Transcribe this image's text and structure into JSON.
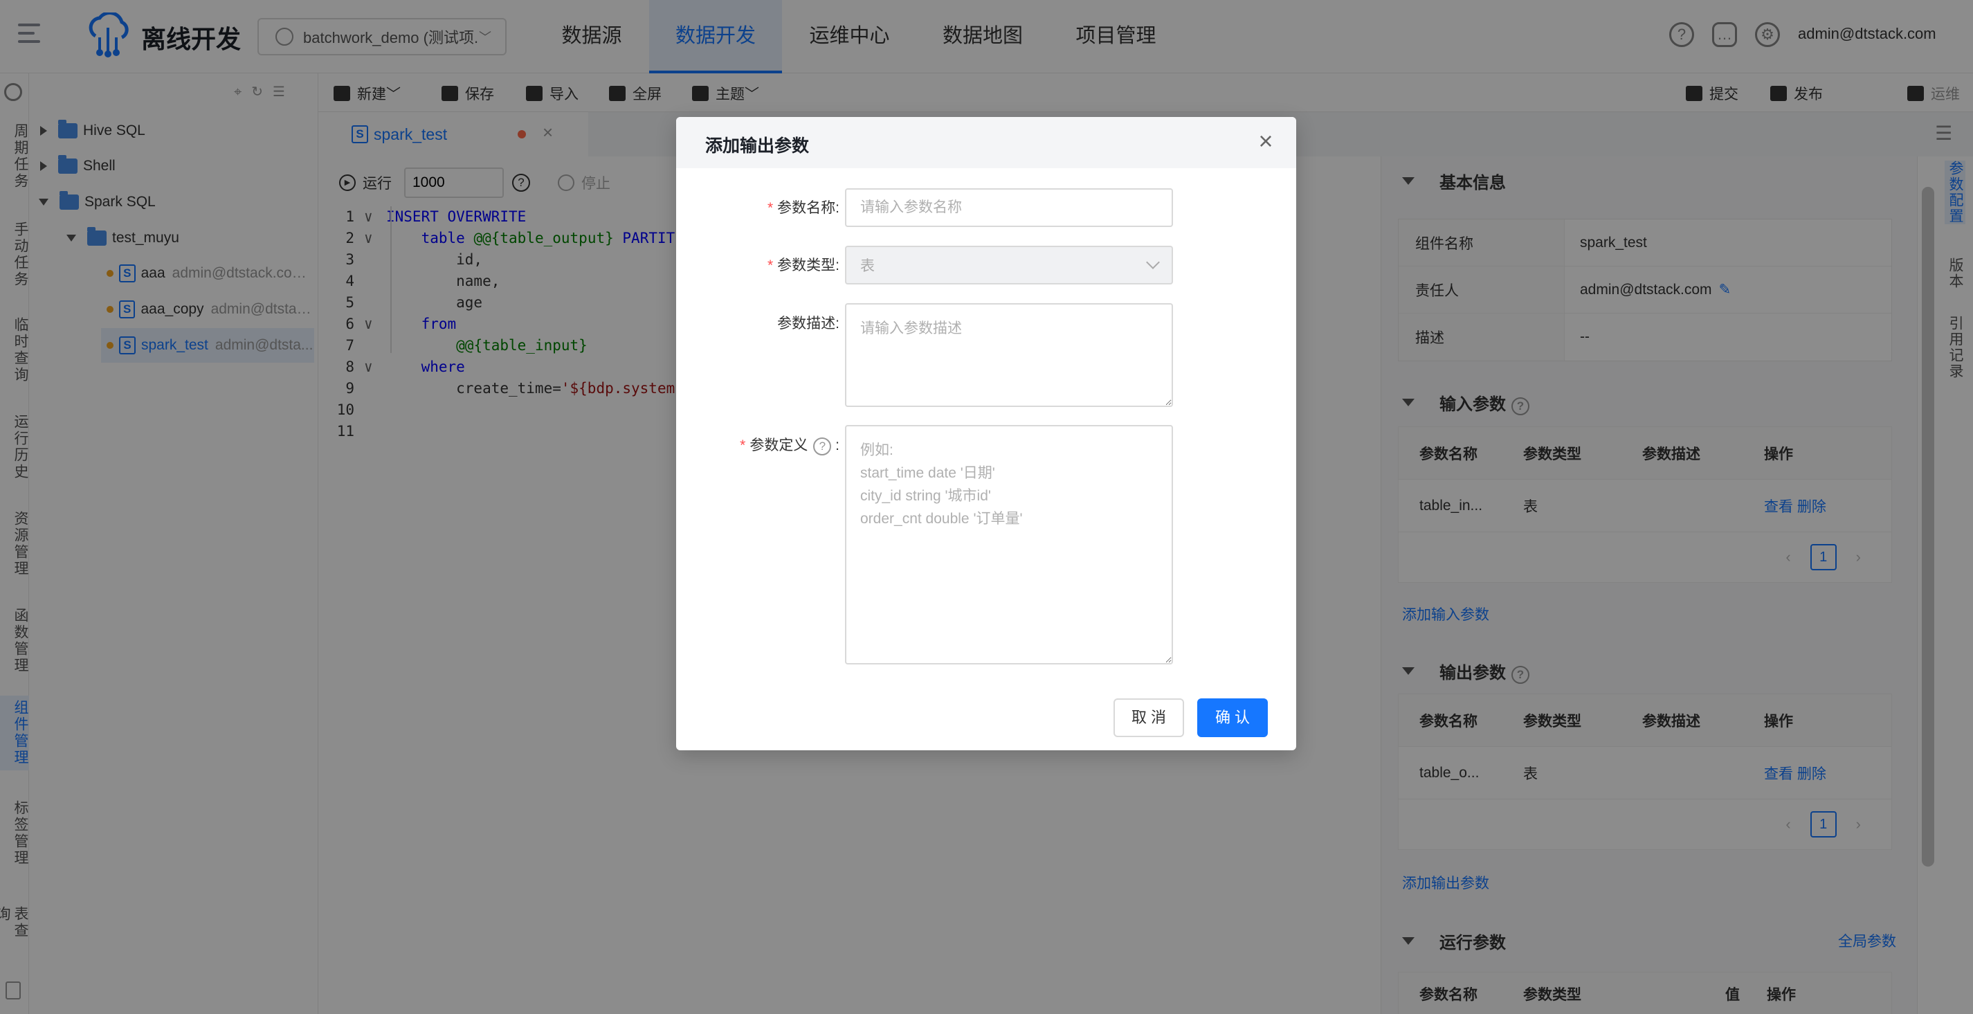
{
  "header": {
    "app_title": "离线开发",
    "project": "batchwork_demo (测试项...",
    "nav": [
      "数据源",
      "数据开发",
      "运维中心",
      "数据地图",
      "项目管理"
    ],
    "active_nav": "数据开发",
    "user": "admin@dtstack.com"
  },
  "left_rail": {
    "items": [
      "周期任务",
      "手动任务",
      "临时查询",
      "运行历史",
      "资源管理",
      "函数管理",
      "组件管理",
      "标签管理",
      "表查询…"
    ]
  },
  "tree": {
    "folders": [
      "Hive SQL",
      "Shell",
      "Spark SQL"
    ],
    "subfolder": "test_muyu",
    "files": [
      {
        "name": "aaa",
        "owner": "admin@dtstack.com..."
      },
      {
        "name": "aaa_copy",
        "owner": "admin@dtstac..."
      },
      {
        "name": "spark_test",
        "owner": "admin@dtsta..."
      }
    ]
  },
  "toolbar": {
    "new": "新建",
    "save": "保存",
    "import": "导入",
    "fullscreen": "全屏",
    "theme": "主题",
    "submit": "提交",
    "publish": "发布",
    "ops": "运维"
  },
  "tab": {
    "name": "spark_test"
  },
  "runbar": {
    "run": "运行",
    "limit": "1000",
    "stop": "停止"
  },
  "code": {
    "lines": [
      {
        "n": "1",
        "parts": [
          [
            "kw",
            "INSERT OVERWRITE"
          ]
        ]
      },
      {
        "n": "2",
        "parts": [
          [
            "",
            "    "
          ],
          [
            "kw",
            "table"
          ],
          [
            "",
            " "
          ],
          [
            "var",
            "@@{table_output}"
          ],
          [
            "",
            " "
          ],
          [
            "kw",
            "PARTITI"
          ]
        ]
      },
      {
        "n": "3",
        "parts": [
          [
            "",
            "        id,"
          ]
        ]
      },
      {
        "n": "4",
        "parts": [
          [
            "",
            "        name,"
          ]
        ]
      },
      {
        "n": "5",
        "parts": [
          [
            "",
            "        age"
          ]
        ]
      },
      {
        "n": "6",
        "parts": [
          [
            "",
            "    "
          ],
          [
            "kw",
            "from"
          ]
        ]
      },
      {
        "n": "7",
        "parts": [
          [
            "",
            "        "
          ],
          [
            "var",
            "@@{table_input}"
          ]
        ]
      },
      {
        "n": "8",
        "parts": [
          [
            "",
            "    "
          ],
          [
            "kw",
            "where"
          ]
        ]
      },
      {
        "n": "9",
        "parts": [
          [
            "",
            "        create_time="
          ],
          [
            "str",
            "'${bdp.system"
          ]
        ]
      },
      {
        "n": "10",
        "parts": []
      },
      {
        "n": "11",
        "parts": []
      }
    ]
  },
  "right_panel": {
    "basic_title": "基本信息",
    "basic": [
      {
        "k": "组件名称",
        "v": "spark_test"
      },
      {
        "k": "责任人",
        "v": "admin@dtstack.com"
      },
      {
        "k": "描述",
        "v": "--"
      }
    ],
    "input_title": "输入参数",
    "output_title": "输出参数",
    "run_title": "运行参数",
    "global_params": "全局参数",
    "cols": [
      "参数名称",
      "参数类型",
      "参数描述",
      "操作"
    ],
    "run_cols": [
      "参数名称",
      "参数类型",
      "值",
      "操作"
    ],
    "input_row": {
      "name": "table_in...",
      "type": "表",
      "view": "查看",
      "del": "删除"
    },
    "output_row": {
      "name": "table_o...",
      "type": "表",
      "view": "查看",
      "del": "删除"
    },
    "page": "1",
    "add_input": "添加输入参数",
    "add_output": "添加输出参数"
  },
  "right_rail": {
    "items": [
      "参数配置",
      "版本",
      "引用记录"
    ]
  },
  "modal": {
    "title": "添加输出参数",
    "name_label": "参数名称:",
    "name_placeholder": "请输入参数名称",
    "type_label": "参数类型:",
    "type_value": "表",
    "desc_label": "参数描述:",
    "desc_placeholder": "请输入参数描述",
    "def_label": "参数定义",
    "def_placeholder": "例如:\nstart_time date '日期'\ncity_id string '城市id'\norder_cnt double '订单量'",
    "cancel": "取 消",
    "ok": "确 认"
  }
}
